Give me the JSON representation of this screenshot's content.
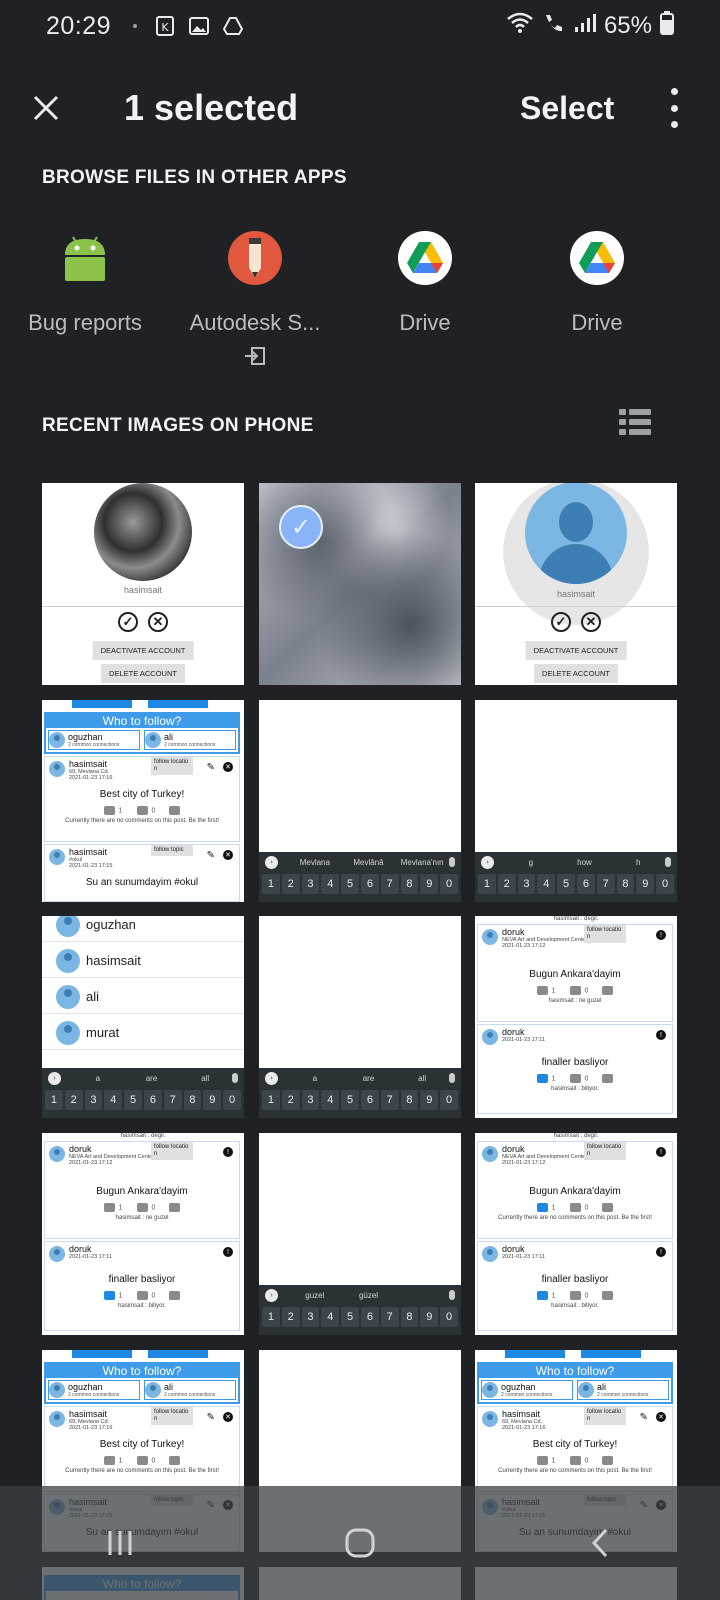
{
  "status": {
    "time": "20:29",
    "battery": "65%"
  },
  "appbar": {
    "title": "1 selected",
    "select_label": "Select"
  },
  "sections": {
    "browse": "BROWSE FILES IN OTHER APPS",
    "recent": "RECENT IMAGES ON PHONE"
  },
  "apps": [
    {
      "label": "Bug reports",
      "icon": "android-icon"
    },
    {
      "label": "Autodesk S...",
      "icon": "autodesk-sketchbook-icon"
    },
    {
      "label": "Drive",
      "icon": "google-drive-icon"
    },
    {
      "label": "Drive",
      "icon": "google-drive-icon"
    }
  ],
  "thumbs": {
    "profile1": {
      "username": "hasimsait",
      "deactivate": "DEACTIVATE ACCOUNT",
      "delete": "DELETE ACCOUNT"
    },
    "profile2": {
      "username": "hasimsait",
      "deactivate": "DEACTIVATE ACCOUNT",
      "delete": "DELETE ACCOUNT"
    },
    "feed": {
      "who_to_follow": "Who to follow?",
      "u1": "oguzhan",
      "u2": "ali",
      "common": "2 common connections",
      "p1_name": "hasimsait",
      "p1_loc": "69, Mevlana Cd.",
      "p1_date": "2021-01-23 17:16",
      "p1_follow": "follow locatio n",
      "p1_text": "Best city of Turkey!",
      "likes": "1",
      "dislikes": "0",
      "no_comments": "Currently there are no comments on this post. Be the first!",
      "p2_name": "hasimsait",
      "p2_tag": "#okul",
      "p2_date": "2021-01-23 17:15",
      "p2_follow": "follow topic",
      "p2_text": "Su an sunumdayim #okul"
    },
    "kb1": {
      "s1": "Mevlana",
      "s2": "Mevlânâ",
      "s3": "Mevlana'nın"
    },
    "kb2": {
      "s1": "g",
      "s2": "how",
      "s3": "h"
    },
    "kb3": {
      "s1": "a",
      "s2": "are",
      "s3": "all"
    },
    "kb4": {
      "s1": "guzel",
      "s2": "güzel",
      "s3": ""
    },
    "users": [
      "oguzhan",
      "hasimsait",
      "ali",
      "murat"
    ],
    "doruk": {
      "top": "hasimsait : degil.",
      "name": "doruk",
      "loc": "NEVA Art and Development Center",
      "date": "2021-01-23 17:12",
      "follow": "follow locatio n",
      "text": "Bugun Ankara'dayim",
      "comment": "hasimsait : ne guzel",
      "p2_name": "doruk",
      "p2_date": "2021-01-23 17:11",
      "p2_text": "finaller basliyor",
      "p2_comment": "hasimsait : bitiyor.",
      "no_comments": "Currently there are no comments on this post. Be the first!"
    },
    "digits": [
      "1",
      "2",
      "3",
      "4",
      "5",
      "6",
      "7",
      "8",
      "9",
      "0"
    ]
  },
  "colors": {
    "background": "#202124",
    "accent": "#8ab4f8",
    "feed_blue": "#3d9be9"
  }
}
